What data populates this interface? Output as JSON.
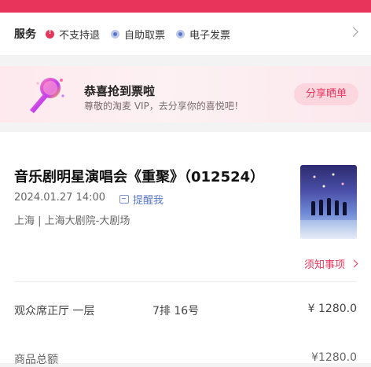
{
  "service": {
    "title": "服务",
    "items": [
      {
        "label": "不支持退",
        "type": "warning"
      },
      {
        "label": "自助取票",
        "type": "info"
      },
      {
        "label": "电子发票",
        "type": "info"
      }
    ]
  },
  "congrats": {
    "title": "恭喜抢到票啦",
    "subtitle": "尊敬的淘麦 VIP，去分享你的喜悦吧！",
    "share_button": "分享晒单"
  },
  "event": {
    "title": "音乐剧明星演唱会《重聚》（012524）",
    "datetime": "2024.01.27 14:00",
    "remind_label": "提醒我",
    "venue": "上海 | 上海大剧院-大剧场",
    "notice_label": "须知事项"
  },
  "ticket": {
    "area": "观众席正厅 一层",
    "seat": "7排 16号",
    "price": "¥ 1280.0"
  },
  "total": {
    "label": "商品总额",
    "price": "¥1280.0"
  },
  "colors": {
    "accent": "#e8345a",
    "link_blue": "#5b78c8"
  }
}
